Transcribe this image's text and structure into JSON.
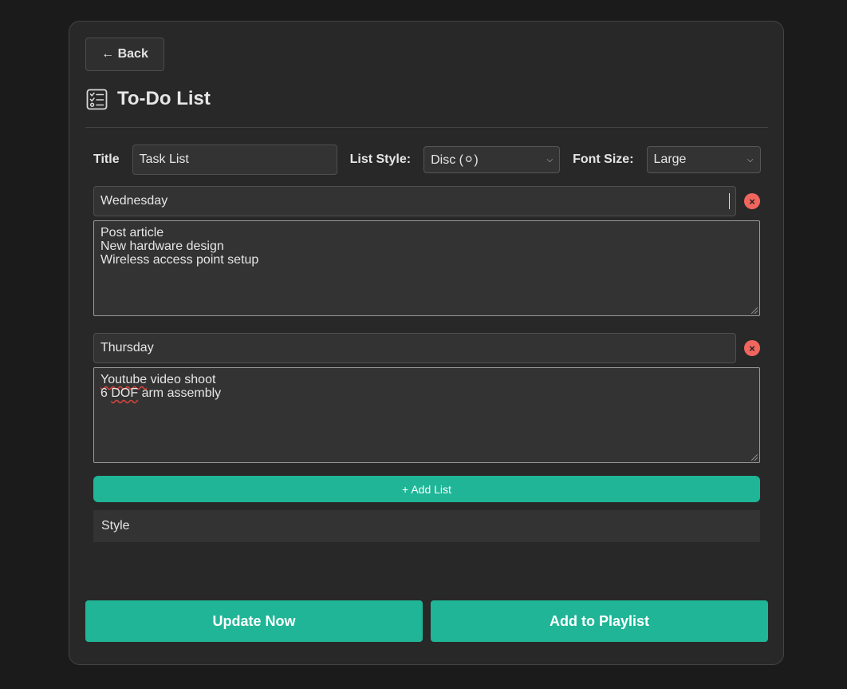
{
  "back_label": "← Back",
  "page_title": "To-Do List",
  "form": {
    "title_label": "Title",
    "title_value": "Task List",
    "list_style_label": "List Style:",
    "list_style_value": "Disc (⚪)",
    "font_size_label": "Font Size:",
    "font_size_value": "Large"
  },
  "lists": [
    {
      "name": "Wednesday",
      "items": [
        "Post article",
        "New hardware design",
        "Wireless access point setup"
      ]
    },
    {
      "name": "Thursday",
      "items": [
        "Youtube video shoot",
        "6 DOF arm assembly"
      ]
    }
  ],
  "remove_icon": "×",
  "add_list_label": "+ Add List",
  "style_label": "Style",
  "update_label": "Update Now",
  "playlist_label": "Add to Playlist",
  "colors": {
    "accent": "#1fb596",
    "remove": "#f0665e",
    "panel": "#282828",
    "background": "#1b1b1b"
  }
}
